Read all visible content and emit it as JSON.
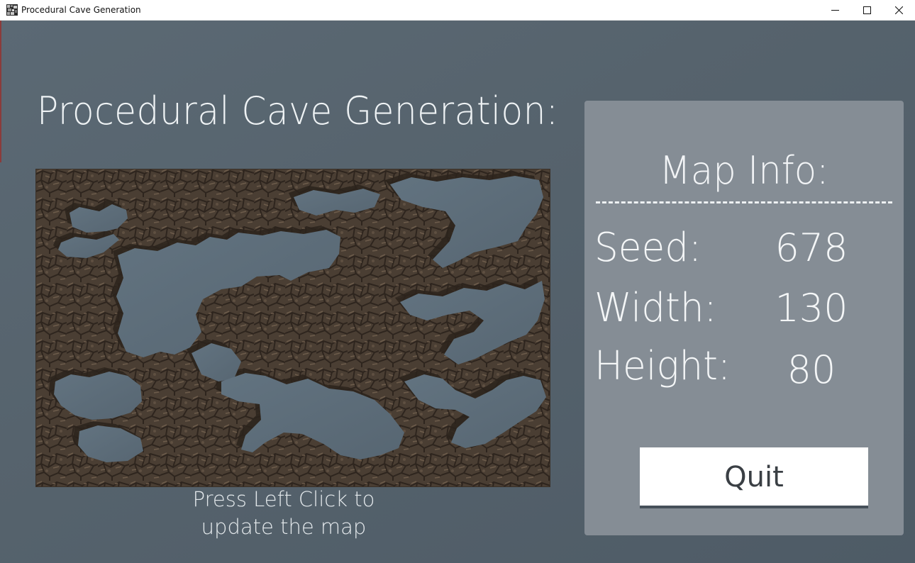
{
  "window": {
    "title": "Procedural Cave Generation",
    "icon": "cave-map-app-icon",
    "controls": [
      "minimize-icon",
      "maximize-icon",
      "close-icon"
    ]
  },
  "main": {
    "title": "Procedural Cave Generation:",
    "hint_line1": "Press Left Click to",
    "hint_line2": "update the map"
  },
  "panel": {
    "title": "Map Info:",
    "seed_label": "Seed:",
    "seed_value": "678",
    "width_label": "Width:",
    "width_value": "130",
    "height_label": "Height:",
    "height_value": "80",
    "quit_label": "Quit"
  },
  "colors": {
    "background": "#56636d",
    "panel": "#858d95",
    "rock": "#4a3e33",
    "cave_floor": "#5c6c79",
    "button": "#ffffff"
  }
}
